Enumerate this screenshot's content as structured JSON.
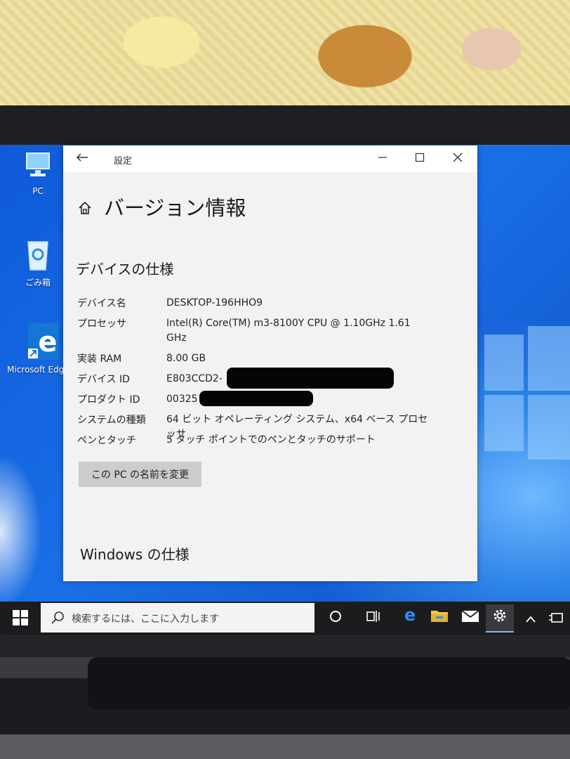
{
  "desktop": {
    "icons": [
      {
        "icon": "pc-icon",
        "label": "PC"
      },
      {
        "icon": "recycle-bin-icon",
        "label": "ごみ箱"
      },
      {
        "icon": "edge-icon",
        "label": "Microsoft Edg"
      }
    ]
  },
  "window": {
    "title": "設定",
    "page_title": "バージョン情報",
    "device_spec_title": "デバイスの仕様",
    "specs": [
      {
        "key": "デバイス名",
        "value": "DESKTOP-196HHO9"
      },
      {
        "key": "プロセッサ",
        "value": "Intel(R) Core(TM) m3-8100Y CPU @ 1.10GHz   1.61 GHz"
      },
      {
        "key": "実装 RAM",
        "value": "8.00 GB"
      },
      {
        "key": "デバイス ID",
        "value": "E803CCD2-"
      },
      {
        "key": "プロダクト ID",
        "value": "00325"
      },
      {
        "key": "システムの種類",
        "value": "64 ビット オペレーティング システム、x64 ベース プロセッサ"
      },
      {
        "key": "ペンとタッチ",
        "value": "5 タッチ ポイントでのペンとタッチのサポート"
      }
    ],
    "rename_button": "この PC の名前を変更",
    "windows_spec_title": "Windows の仕様"
  },
  "taskbar": {
    "search_placeholder": "検索するには、ここに入力します",
    "icons": [
      "start-icon",
      "cortana-icon",
      "task-view-icon",
      "edge-icon",
      "file-explorer-icon",
      "mail-icon",
      "settings-icon",
      "chevron-up-icon",
      "tablet-icon"
    ]
  },
  "colors": {
    "desktop_blue": "#1a6fe6",
    "window_bg": "#f2f2f2",
    "taskbar": "#1c1c1f"
  }
}
